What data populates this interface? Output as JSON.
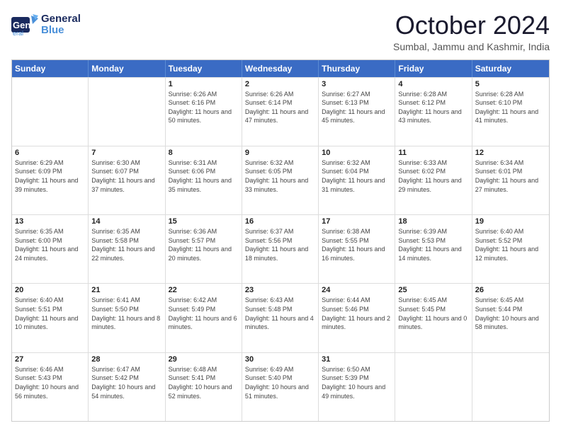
{
  "logo": {
    "line1": "General",
    "line2": "Blue"
  },
  "title": "October 2024",
  "location": "Sumbal, Jammu and Kashmir, India",
  "header": {
    "days": [
      "Sunday",
      "Monday",
      "Tuesday",
      "Wednesday",
      "Thursday",
      "Friday",
      "Saturday"
    ]
  },
  "rows": [
    [
      {
        "date": "",
        "sunrise": "",
        "sunset": "",
        "daylight": ""
      },
      {
        "date": "",
        "sunrise": "",
        "sunset": "",
        "daylight": ""
      },
      {
        "date": "1",
        "sunrise": "Sunrise: 6:26 AM",
        "sunset": "Sunset: 6:16 PM",
        "daylight": "Daylight: 11 hours and 50 minutes."
      },
      {
        "date": "2",
        "sunrise": "Sunrise: 6:26 AM",
        "sunset": "Sunset: 6:14 PM",
        "daylight": "Daylight: 11 hours and 47 minutes."
      },
      {
        "date": "3",
        "sunrise": "Sunrise: 6:27 AM",
        "sunset": "Sunset: 6:13 PM",
        "daylight": "Daylight: 11 hours and 45 minutes."
      },
      {
        "date": "4",
        "sunrise": "Sunrise: 6:28 AM",
        "sunset": "Sunset: 6:12 PM",
        "daylight": "Daylight: 11 hours and 43 minutes."
      },
      {
        "date": "5",
        "sunrise": "Sunrise: 6:28 AM",
        "sunset": "Sunset: 6:10 PM",
        "daylight": "Daylight: 11 hours and 41 minutes."
      }
    ],
    [
      {
        "date": "6",
        "sunrise": "Sunrise: 6:29 AM",
        "sunset": "Sunset: 6:09 PM",
        "daylight": "Daylight: 11 hours and 39 minutes."
      },
      {
        "date": "7",
        "sunrise": "Sunrise: 6:30 AM",
        "sunset": "Sunset: 6:07 PM",
        "daylight": "Daylight: 11 hours and 37 minutes."
      },
      {
        "date": "8",
        "sunrise": "Sunrise: 6:31 AM",
        "sunset": "Sunset: 6:06 PM",
        "daylight": "Daylight: 11 hours and 35 minutes."
      },
      {
        "date": "9",
        "sunrise": "Sunrise: 6:32 AM",
        "sunset": "Sunset: 6:05 PM",
        "daylight": "Daylight: 11 hours and 33 minutes."
      },
      {
        "date": "10",
        "sunrise": "Sunrise: 6:32 AM",
        "sunset": "Sunset: 6:04 PM",
        "daylight": "Daylight: 11 hours and 31 minutes."
      },
      {
        "date": "11",
        "sunrise": "Sunrise: 6:33 AM",
        "sunset": "Sunset: 6:02 PM",
        "daylight": "Daylight: 11 hours and 29 minutes."
      },
      {
        "date": "12",
        "sunrise": "Sunrise: 6:34 AM",
        "sunset": "Sunset: 6:01 PM",
        "daylight": "Daylight: 11 hours and 27 minutes."
      }
    ],
    [
      {
        "date": "13",
        "sunrise": "Sunrise: 6:35 AM",
        "sunset": "Sunset: 6:00 PM",
        "daylight": "Daylight: 11 hours and 24 minutes."
      },
      {
        "date": "14",
        "sunrise": "Sunrise: 6:35 AM",
        "sunset": "Sunset: 5:58 PM",
        "daylight": "Daylight: 11 hours and 22 minutes."
      },
      {
        "date": "15",
        "sunrise": "Sunrise: 6:36 AM",
        "sunset": "Sunset: 5:57 PM",
        "daylight": "Daylight: 11 hours and 20 minutes."
      },
      {
        "date": "16",
        "sunrise": "Sunrise: 6:37 AM",
        "sunset": "Sunset: 5:56 PM",
        "daylight": "Daylight: 11 hours and 18 minutes."
      },
      {
        "date": "17",
        "sunrise": "Sunrise: 6:38 AM",
        "sunset": "Sunset: 5:55 PM",
        "daylight": "Daylight: 11 hours and 16 minutes."
      },
      {
        "date": "18",
        "sunrise": "Sunrise: 6:39 AM",
        "sunset": "Sunset: 5:53 PM",
        "daylight": "Daylight: 11 hours and 14 minutes."
      },
      {
        "date": "19",
        "sunrise": "Sunrise: 6:40 AM",
        "sunset": "Sunset: 5:52 PM",
        "daylight": "Daylight: 11 hours and 12 minutes."
      }
    ],
    [
      {
        "date": "20",
        "sunrise": "Sunrise: 6:40 AM",
        "sunset": "Sunset: 5:51 PM",
        "daylight": "Daylight: 11 hours and 10 minutes."
      },
      {
        "date": "21",
        "sunrise": "Sunrise: 6:41 AM",
        "sunset": "Sunset: 5:50 PM",
        "daylight": "Daylight: 11 hours and 8 minutes."
      },
      {
        "date": "22",
        "sunrise": "Sunrise: 6:42 AM",
        "sunset": "Sunset: 5:49 PM",
        "daylight": "Daylight: 11 hours and 6 minutes."
      },
      {
        "date": "23",
        "sunrise": "Sunrise: 6:43 AM",
        "sunset": "Sunset: 5:48 PM",
        "daylight": "Daylight: 11 hours and 4 minutes."
      },
      {
        "date": "24",
        "sunrise": "Sunrise: 6:44 AM",
        "sunset": "Sunset: 5:46 PM",
        "daylight": "Daylight: 11 hours and 2 minutes."
      },
      {
        "date": "25",
        "sunrise": "Sunrise: 6:45 AM",
        "sunset": "Sunset: 5:45 PM",
        "daylight": "Daylight: 11 hours and 0 minutes."
      },
      {
        "date": "26",
        "sunrise": "Sunrise: 6:45 AM",
        "sunset": "Sunset: 5:44 PM",
        "daylight": "Daylight: 10 hours and 58 minutes."
      }
    ],
    [
      {
        "date": "27",
        "sunrise": "Sunrise: 6:46 AM",
        "sunset": "Sunset: 5:43 PM",
        "daylight": "Daylight: 10 hours and 56 minutes."
      },
      {
        "date": "28",
        "sunrise": "Sunrise: 6:47 AM",
        "sunset": "Sunset: 5:42 PM",
        "daylight": "Daylight: 10 hours and 54 minutes."
      },
      {
        "date": "29",
        "sunrise": "Sunrise: 6:48 AM",
        "sunset": "Sunset: 5:41 PM",
        "daylight": "Daylight: 10 hours and 52 minutes."
      },
      {
        "date": "30",
        "sunrise": "Sunrise: 6:49 AM",
        "sunset": "Sunset: 5:40 PM",
        "daylight": "Daylight: 10 hours and 51 minutes."
      },
      {
        "date": "31",
        "sunrise": "Sunrise: 6:50 AM",
        "sunset": "Sunset: 5:39 PM",
        "daylight": "Daylight: 10 hours and 49 minutes."
      },
      {
        "date": "",
        "sunrise": "",
        "sunset": "",
        "daylight": ""
      },
      {
        "date": "",
        "sunrise": "",
        "sunset": "",
        "daylight": ""
      }
    ]
  ]
}
